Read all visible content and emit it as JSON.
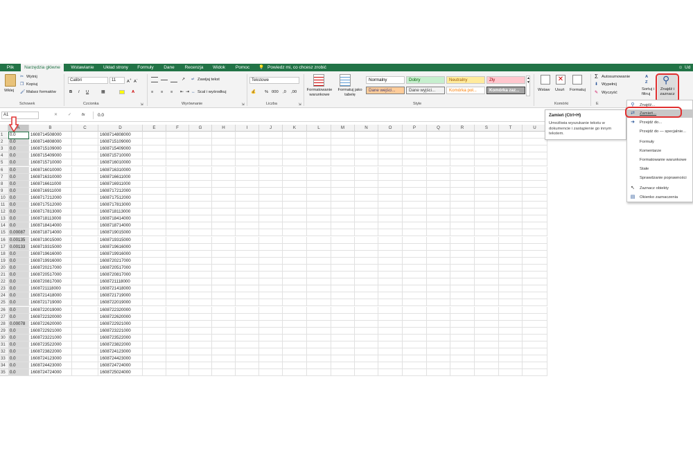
{
  "menu": {
    "tabs": [
      "Plik",
      "Narzędzia główne",
      "Wstawianie",
      "Układ strony",
      "Formuły",
      "Dane",
      "Recenzja",
      "Widok",
      "Pomoc"
    ],
    "tell_me": "Powiedz mi, co chcesz zrobić",
    "user": "Ud"
  },
  "ribbon": {
    "clipboard": {
      "paste": "Wklej",
      "cut": "Wytnij",
      "copy": "Kopiuj",
      "format_painter": "Malarz formatów",
      "label": "Schowek"
    },
    "font": {
      "name": "Calibri",
      "size": "11",
      "bold": "B",
      "italic": "I",
      "underline": "U",
      "label": "Czcionka"
    },
    "alignment": {
      "wrap": "Zawijaj tekst",
      "merge": "Scal i wyśrodkuj",
      "label": "Wyrównanie"
    },
    "number": {
      "format": "Tekstowe",
      "percent": "%",
      "label": "Liczba"
    },
    "styles": {
      "conditional": "Formatowanie warunkowe",
      "as_table": "Formatuj jako tabelę",
      "cells": [
        {
          "text": "Normalny",
          "bg": "#ffffff",
          "fg": "#000000"
        },
        {
          "text": "Dobry",
          "bg": "#c6efce",
          "fg": "#006100"
        },
        {
          "text": "Neutralny",
          "bg": "#ffeb9c",
          "fg": "#9c5700"
        },
        {
          "text": "Zły",
          "bg": "#ffc7ce",
          "fg": "#9c0006"
        },
        {
          "text": "Dane wejści...",
          "bg": "#ffcc99",
          "fg": "#3f3f76"
        },
        {
          "text": "Dane wyjści...",
          "bg": "#f2f2f2",
          "fg": "#3f3f3f"
        },
        {
          "text": "Komórka poł...",
          "bg": "#ffffff",
          "fg": "#fa7d00"
        },
        {
          "text": "Komórka zaz...",
          "bg": "#a5a5a5",
          "fg": "#ffffff"
        }
      ],
      "label": "Style"
    },
    "cells": {
      "insert": "Wstaw",
      "delete": "Usuń",
      "format": "Formatuj",
      "label": "Komórki"
    },
    "editing": {
      "autosum": "Autosumowanie",
      "fill": "Wypełnij",
      "clear": "Wyczyść",
      "sort": "Sortuj i filtruj",
      "find": "Znajdź i zaznacz",
      "label": "E"
    }
  },
  "formula_bar": {
    "name_box": "A1",
    "fx": "fx",
    "value": "0.0"
  },
  "columns": [
    "A",
    "B",
    "C",
    "D",
    "E",
    "F",
    "G",
    "H",
    "I",
    "J",
    "K",
    "L",
    "M",
    "N",
    "O",
    "P",
    "Q",
    "R",
    "S",
    "T",
    "U"
  ],
  "rows": [
    {
      "n": "1",
      "a": "0.0",
      "b": "1608714508000",
      "d": "1608714808000"
    },
    {
      "n": "2",
      "a": "0.0",
      "b": "1608714808000",
      "d": "1608715109000"
    },
    {
      "n": "3",
      "a": "0.0",
      "b": "1608715109000",
      "d": "1608715409000"
    },
    {
      "n": "4",
      "a": "0.0",
      "b": "1608715409000",
      "d": "1608715710000"
    },
    {
      "n": "5",
      "a": "0.0",
      "b": "1608715710000",
      "d": "1608716010000"
    },
    {
      "n": "6",
      "a": "0.0",
      "b": "1608716010000",
      "d": "1608716310000"
    },
    {
      "n": "7",
      "a": "0.0",
      "b": "1608716310000",
      "d": "1608716611000"
    },
    {
      "n": "8",
      "a": "0.0",
      "b": "1608716611000",
      "d": "1608716911000"
    },
    {
      "n": "9",
      "a": "0.0",
      "b": "1608716911000",
      "d": "1608717212000"
    },
    {
      "n": "10",
      "a": "0.0",
      "b": "1608717212000",
      "d": "1608717512000"
    },
    {
      "n": "11",
      "a": "0.0",
      "b": "1608717512000",
      "d": "1608717813000"
    },
    {
      "n": "12",
      "a": "0.0",
      "b": "1608717813000",
      "d": "1608718113000"
    },
    {
      "n": "13",
      "a": "0.0",
      "b": "1608718113000",
      "d": "1608718414000"
    },
    {
      "n": "14",
      "a": "0.0",
      "b": "1608718414000",
      "d": "1608718714000"
    },
    {
      "n": "15",
      "a": "0.00087",
      "b": "1608718714000",
      "d": "1608719015000"
    },
    {
      "n": "16",
      "a": "0.00135",
      "b": "1608719015000",
      "d": "1608719315000"
    },
    {
      "n": "17",
      "a": "0.00133",
      "b": "1608719315000",
      "d": "1608719616000"
    },
    {
      "n": "18",
      "a": "0.0",
      "b": "1608719616000",
      "d": "1608719916000"
    },
    {
      "n": "19",
      "a": "0.0",
      "b": "1608719916000",
      "d": "1608720217000"
    },
    {
      "n": "20",
      "a": "0.0",
      "b": "1608720217000",
      "d": "1608720517000"
    },
    {
      "n": "21",
      "a": "0.0",
      "b": "1608720517000",
      "d": "1608720817000"
    },
    {
      "n": "22",
      "a": "0.0",
      "b": "1608720817000",
      "d": "1608721118000"
    },
    {
      "n": "23",
      "a": "0.0",
      "b": "1608721118000",
      "d": "1608721418000"
    },
    {
      "n": "24",
      "a": "0.0",
      "b": "1608721418000",
      "d": "1608721719000"
    },
    {
      "n": "25",
      "a": "0.0",
      "b": "1608721719000",
      "d": "1608722019000"
    },
    {
      "n": "26",
      "a": "0.0",
      "b": "1608722019000",
      "d": "1608722320000"
    },
    {
      "n": "27",
      "a": "0.0",
      "b": "1608722320000",
      "d": "1608722620000"
    },
    {
      "n": "28",
      "a": "0.00078",
      "b": "1608722620000",
      "d": "1608722921000"
    },
    {
      "n": "29",
      "a": "0.0",
      "b": "1608722921000",
      "d": "1608723221000"
    },
    {
      "n": "30",
      "a": "0.0",
      "b": "1608723221000",
      "d": "1608723522000"
    },
    {
      "n": "31",
      "a": "0.0",
      "b": "1608723522000",
      "d": "1608723822000"
    },
    {
      "n": "32",
      "a": "0.0",
      "b": "1608723822000",
      "d": "1608724123000"
    },
    {
      "n": "33",
      "a": "0.0",
      "b": "1608724123000",
      "d": "1608724423000"
    },
    {
      "n": "34",
      "a": "0.0",
      "b": "1608724423000",
      "d": "1608724724000"
    },
    {
      "n": "35",
      "a": "0.0",
      "b": "1608724724000",
      "d": "1608725024000"
    }
  ],
  "tooltip": {
    "title": "Zamień (Ctrl+H)",
    "body": "Umożliwia wyszukanie tekstu w dokumencie i zastąpienie go innym tekstem."
  },
  "dropdown": [
    "Znajdź...",
    "Zamień...",
    "Przejdź do...",
    "Przejdź do — specjalnie...",
    "Formuły",
    "Komentarze",
    "Formatowanie warunkowe",
    "Stałe",
    "Sprawdzanie poprawności",
    "Zaznacz obiekty",
    "Okienko zaznaczenia"
  ],
  "colors": {
    "excel_green": "#217346",
    "highlight": "#e03030",
    "ribbon_bg": "#f3f3f3"
  }
}
